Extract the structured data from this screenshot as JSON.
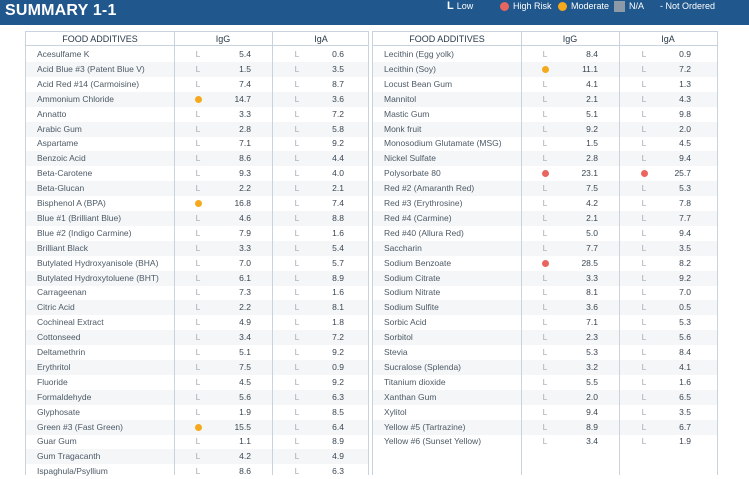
{
  "title": "SUMMARY 1-1",
  "legend": {
    "low_mark": "L",
    "low_label": "Low",
    "high_label": "High Risk",
    "moderate_label": "Moderate",
    "na_label": "N/A",
    "not_ordered_label": "- Not Ordered"
  },
  "colors": {
    "header_bg": "#20578c",
    "high": "#e8665f",
    "moderate": "#f5a91c",
    "na": "#8c9aa8"
  },
  "columns": {
    "name": "FOOD ADDITIVES",
    "igg": "IgG",
    "iga": "IgA"
  },
  "left_rows": [
    {
      "name": "Acesulfame K",
      "igg_level": "L",
      "igg": "5.4",
      "iga_level": "L",
      "iga": "0.6"
    },
    {
      "name": "Acid Blue #3 (Patent Blue V)",
      "igg_level": "L",
      "igg": "1.5",
      "iga_level": "L",
      "iga": "3.5"
    },
    {
      "name": "Acid Red #14 (Carmoisine)",
      "igg_level": "L",
      "igg": "7.4",
      "iga_level": "L",
      "iga": "8.7"
    },
    {
      "name": "Ammonium Chloride",
      "igg_level": "moderate",
      "igg": "14.7",
      "iga_level": "L",
      "iga": "3.6"
    },
    {
      "name": "Annatto",
      "igg_level": "L",
      "igg": "3.3",
      "iga_level": "L",
      "iga": "7.2"
    },
    {
      "name": "Arabic Gum",
      "igg_level": "L",
      "igg": "2.8",
      "iga_level": "L",
      "iga": "5.8"
    },
    {
      "name": "Aspartame",
      "igg_level": "L",
      "igg": "7.1",
      "iga_level": "L",
      "iga": "9.2"
    },
    {
      "name": "Benzoic Acid",
      "igg_level": "L",
      "igg": "8.6",
      "iga_level": "L",
      "iga": "4.4"
    },
    {
      "name": "Beta-Carotene",
      "igg_level": "L",
      "igg": "9.3",
      "iga_level": "L",
      "iga": "4.0"
    },
    {
      "name": "Beta-Glucan",
      "igg_level": "L",
      "igg": "2.2",
      "iga_level": "L",
      "iga": "2.1"
    },
    {
      "name": "Bisphenol A (BPA)",
      "igg_level": "moderate",
      "igg": "16.8",
      "iga_level": "L",
      "iga": "7.4"
    },
    {
      "name": "Blue #1 (Brilliant Blue)",
      "igg_level": "L",
      "igg": "4.6",
      "iga_level": "L",
      "iga": "8.8"
    },
    {
      "name": "Blue #2 (Indigo Carmine)",
      "igg_level": "L",
      "igg": "7.9",
      "iga_level": "L",
      "iga": "1.6"
    },
    {
      "name": "Brilliant Black",
      "igg_level": "L",
      "igg": "3.3",
      "iga_level": "L",
      "iga": "5.4"
    },
    {
      "name": "Butylated Hydroxyanisole (BHA)",
      "igg_level": "L",
      "igg": "7.0",
      "iga_level": "L",
      "iga": "5.7"
    },
    {
      "name": "Butylated Hydroxytoluene (BHT)",
      "igg_level": "L",
      "igg": "6.1",
      "iga_level": "L",
      "iga": "8.9"
    },
    {
      "name": "Carrageenan",
      "igg_level": "L",
      "igg": "7.3",
      "iga_level": "L",
      "iga": "1.6"
    },
    {
      "name": "Citric Acid",
      "igg_level": "L",
      "igg": "2.2",
      "iga_level": "L",
      "iga": "8.1"
    },
    {
      "name": "Cochineal Extract",
      "igg_level": "L",
      "igg": "4.9",
      "iga_level": "L",
      "iga": "1.8"
    },
    {
      "name": "Cottonseed",
      "igg_level": "L",
      "igg": "3.4",
      "iga_level": "L",
      "iga": "7.2"
    },
    {
      "name": "Deltamethrin",
      "igg_level": "L",
      "igg": "5.1",
      "iga_level": "L",
      "iga": "9.2"
    },
    {
      "name": "Erythritol",
      "igg_level": "L",
      "igg": "7.5",
      "iga_level": "L",
      "iga": "0.9"
    },
    {
      "name": "Fluoride",
      "igg_level": "L",
      "igg": "4.5",
      "iga_level": "L",
      "iga": "9.2"
    },
    {
      "name": "Formaldehyde",
      "igg_level": "L",
      "igg": "5.6",
      "iga_level": "L",
      "iga": "6.3"
    },
    {
      "name": "Glyphosate",
      "igg_level": "L",
      "igg": "1.9",
      "iga_level": "L",
      "iga": "8.5"
    },
    {
      "name": "Green #3 (Fast Green)",
      "igg_level": "moderate",
      "igg": "15.5",
      "iga_level": "L",
      "iga": "6.4"
    },
    {
      "name": "Guar Gum",
      "igg_level": "L",
      "igg": "1.1",
      "iga_level": "L",
      "iga": "8.9"
    },
    {
      "name": "Gum Tragacanth",
      "igg_level": "L",
      "igg": "4.2",
      "iga_level": "L",
      "iga": "4.9"
    },
    {
      "name": "Ispaghula/Psyllium",
      "igg_level": "L",
      "igg": "8.6",
      "iga_level": "L",
      "iga": "6.3"
    }
  ],
  "right_rows": [
    {
      "name": "Lecithin (Egg yolk)",
      "igg_level": "L",
      "igg": "8.4",
      "iga_level": "L",
      "iga": "0.9"
    },
    {
      "name": "Lecithin (Soy)",
      "igg_level": "moderate",
      "igg": "11.1",
      "iga_level": "L",
      "iga": "7.2"
    },
    {
      "name": "Locust Bean Gum",
      "igg_level": "L",
      "igg": "4.1",
      "iga_level": "L",
      "iga": "1.3"
    },
    {
      "name": "Mannitol",
      "igg_level": "L",
      "igg": "2.1",
      "iga_level": "L",
      "iga": "4.3"
    },
    {
      "name": "Mastic Gum",
      "igg_level": "L",
      "igg": "5.1",
      "iga_level": "L",
      "iga": "9.8"
    },
    {
      "name": "Monk fruit",
      "igg_level": "L",
      "igg": "9.2",
      "iga_level": "L",
      "iga": "2.0"
    },
    {
      "name": "Monosodium Glutamate (MSG)",
      "igg_level": "L",
      "igg": "1.5",
      "iga_level": "L",
      "iga": "4.5"
    },
    {
      "name": "Nickel Sulfate",
      "igg_level": "L",
      "igg": "2.8",
      "iga_level": "L",
      "iga": "9.4"
    },
    {
      "name": "Polysorbate 80",
      "igg_level": "high",
      "igg": "23.1",
      "iga_level": "high",
      "iga": "25.7"
    },
    {
      "name": "Red #2 (Amaranth Red)",
      "igg_level": "L",
      "igg": "7.5",
      "iga_level": "L",
      "iga": "5.3"
    },
    {
      "name": "Red #3 (Erythrosine)",
      "igg_level": "L",
      "igg": "4.2",
      "iga_level": "L",
      "iga": "7.8"
    },
    {
      "name": "Red #4 (Carmine)",
      "igg_level": "L",
      "igg": "2.1",
      "iga_level": "L",
      "iga": "7.7"
    },
    {
      "name": "Red #40 (Allura Red)",
      "igg_level": "L",
      "igg": "5.0",
      "iga_level": "L",
      "iga": "9.4"
    },
    {
      "name": "Saccharin",
      "igg_level": "L",
      "igg": "7.7",
      "iga_level": "L",
      "iga": "3.5"
    },
    {
      "name": "Sodium Benzoate",
      "igg_level": "high",
      "igg": "28.5",
      "iga_level": "L",
      "iga": "8.2"
    },
    {
      "name": "Sodium Citrate",
      "igg_level": "L",
      "igg": "3.3",
      "iga_level": "L",
      "iga": "9.2"
    },
    {
      "name": "Sodium Nitrate",
      "igg_level": "L",
      "igg": "8.1",
      "iga_level": "L",
      "iga": "7.0"
    },
    {
      "name": "Sodium Sulfite",
      "igg_level": "L",
      "igg": "3.6",
      "iga_level": "L",
      "iga": "0.5"
    },
    {
      "name": "Sorbic Acid",
      "igg_level": "L",
      "igg": "7.1",
      "iga_level": "L",
      "iga": "5.3"
    },
    {
      "name": "Sorbitol",
      "igg_level": "L",
      "igg": "2.3",
      "iga_level": "L",
      "iga": "5.6"
    },
    {
      "name": "Stevia",
      "igg_level": "L",
      "igg": "5.3",
      "iga_level": "L",
      "iga": "8.4"
    },
    {
      "name": "Sucralose (Splenda)",
      "igg_level": "L",
      "igg": "3.2",
      "iga_level": "L",
      "iga": "4.1"
    },
    {
      "name": "Titanium dioxide",
      "igg_level": "L",
      "igg": "5.5",
      "iga_level": "L",
      "iga": "1.6"
    },
    {
      "name": "Xanthan Gum",
      "igg_level": "L",
      "igg": "2.0",
      "iga_level": "L",
      "iga": "6.5"
    },
    {
      "name": "Xylitol",
      "igg_level": "L",
      "igg": "9.4",
      "iga_level": "L",
      "iga": "3.5"
    },
    {
      "name": "Yellow #5 (Tartrazine)",
      "igg_level": "L",
      "igg": "8.9",
      "iga_level": "L",
      "iga": "6.7"
    },
    {
      "name": "Yellow #6 (Sunset Yellow)",
      "igg_level": "L",
      "igg": "3.4",
      "iga_level": "L",
      "iga": "1.9"
    }
  ]
}
